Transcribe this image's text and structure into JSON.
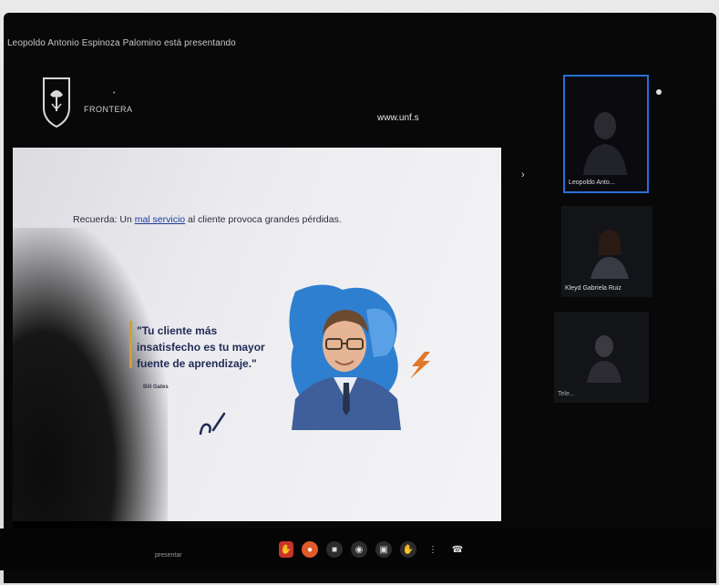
{
  "meeting": {
    "presenter_banner": "Leopoldo Antonio Espinoza Palomino está presentando"
  },
  "slide": {
    "institution_name": "FRONTERA",
    "url_text": "www.unf.s",
    "heading_pre": "Recuerda: Un ",
    "heading_link": "mal servicio",
    "heading_post": " al cliente provoca grandes pérdidas.",
    "quote_line_1": "\"Tu cliente más",
    "quote_line_2": "insatisfecho es tu mayor",
    "quote_line_3": "fuente de aprendizaje.\"",
    "quote_author": "Bill Gates",
    "colors": {
      "link": "#1d3c9c",
      "quote_text": "#1f2a55",
      "quote_bar": "#d0a030",
      "accent_orange": "#e0782a",
      "portrait_blob": "#2f7fd0"
    }
  },
  "participants": [
    {
      "name": "Leopoldo Anto...",
      "active": true
    },
    {
      "name": "Kleyd Gabriela Ruiz"
    },
    {
      "name": "Tele..."
    }
  ],
  "toolbar": {
    "label": "presentar",
    "buttons": [
      {
        "icon": "raise-hand-icon",
        "glyph": "✋",
        "color": "#c8332a"
      },
      {
        "icon": "mic-off-icon",
        "glyph": "●",
        "color": "#e05a2a"
      },
      {
        "icon": "camera-icon",
        "glyph": "■"
      },
      {
        "icon": "captions-icon",
        "glyph": "◉"
      },
      {
        "icon": "present-icon",
        "glyph": "▣"
      },
      {
        "icon": "hand-icon",
        "glyph": "✋"
      },
      {
        "icon": "more-icon",
        "glyph": "⋮"
      },
      {
        "icon": "leave-icon",
        "glyph": "☎"
      }
    ]
  }
}
